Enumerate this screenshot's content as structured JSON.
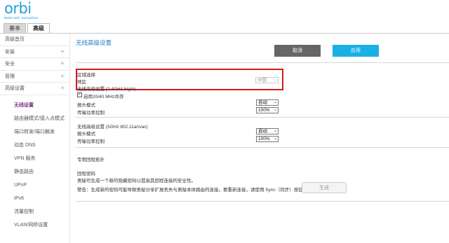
{
  "brand": {
    "logo": "orbi",
    "tagline": "Better WiFi. Everywhere"
  },
  "tabs": {
    "basic": "基本",
    "advanced": "高级"
  },
  "sidebar": {
    "items": [
      {
        "label": "高级首页",
        "plus": ""
      },
      {
        "label": "安装",
        "plus": "+"
      },
      {
        "label": "安全",
        "plus": "+"
      },
      {
        "label": "管理",
        "plus": "+"
      },
      {
        "label": "高级设置",
        "plus": "+"
      }
    ],
    "sub_items": [
      "无线设置",
      "路由器模式/接入点模式",
      "端口转发/端口触发",
      "动态 DNS",
      "VPN 服务",
      "静态路由",
      "UPnP",
      "IPv6",
      "流量控制",
      "VLAN/网桥设置"
    ]
  },
  "main": {
    "title": "无线高级设置",
    "cancel_label": "取消",
    "apply_label": "应用",
    "region_heading": "区域选择",
    "region_label": "地区",
    "region_value": "中国",
    "adv24_heading": "无线高级设置 (2.4GHz b/g/n)",
    "coexist_label": "启用20/40 MHz共存",
    "preamble_label": "报头模式",
    "preamble_value": "自动",
    "power_label": "传输功率控制",
    "power_value": "100%",
    "adv5_heading": "无线高级设置 (5GHz 802.11a/n/ac)",
    "preamble5_label": "报头模式",
    "preamble5_value": "自动",
    "power5_label": "传输功率控制",
    "power5_value": "100%",
    "backhaul_heading": "专用回程拓扑",
    "backhaul_pw_heading": "回程密码",
    "backhaul_desc": "奥秘可生成一个新的隐藏密码以提高其回程连接的安全性。",
    "backhaul_warning": "警告：生成新的密码可能导致奥秘分享扩展丢失与奥秘本体路由的连接。要重新连接，请使用 Sync（同步）按钮。",
    "generate_label": "生成"
  }
}
